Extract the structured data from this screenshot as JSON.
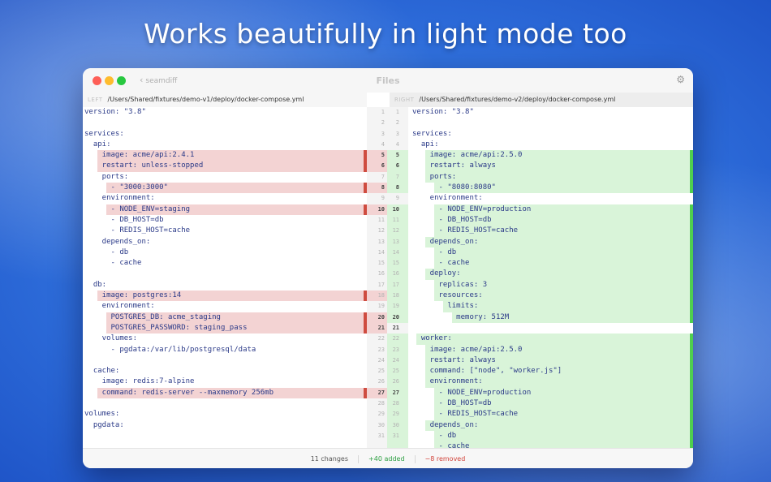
{
  "headline": "Works beautifully in light mode too",
  "window": {
    "title": "Files",
    "back_label": "seamdiff",
    "left_label": "LEFT",
    "left_path": "/Users/Shared/fixtures/demo-v1/deploy/docker-compose.yml",
    "right_label": "RIGHT",
    "right_path": "/Users/Shared/fixtures/demo-v2/deploy/docker-compose.yml"
  },
  "left_lines": [
    {
      "text": "version: \"3.8\"",
      "state": ""
    },
    {
      "text": "",
      "state": ""
    },
    {
      "text": "services:",
      "state": ""
    },
    {
      "text": "  api:",
      "state": ""
    },
    {
      "text": "    image: acme/api:2.4.1",
      "state": "del"
    },
    {
      "text": "    restart: unless-stopped",
      "state": "del"
    },
    {
      "text": "    ports:",
      "state": ""
    },
    {
      "text": "      - \"3000:3000\"",
      "state": "del"
    },
    {
      "text": "    environment:",
      "state": ""
    },
    {
      "text": "      - NODE_ENV=staging",
      "state": "del"
    },
    {
      "text": "      - DB_HOST=db",
      "state": ""
    },
    {
      "text": "      - REDIS_HOST=cache",
      "state": ""
    },
    {
      "text": "    depends_on:",
      "state": ""
    },
    {
      "text": "      - db",
      "state": ""
    },
    {
      "text": "      - cache",
      "state": ""
    },
    {
      "text": "",
      "state": ""
    },
    {
      "text": "  db:",
      "state": ""
    },
    {
      "text": "    image: postgres:14",
      "state": "del"
    },
    {
      "text": "    environment:",
      "state": ""
    },
    {
      "text": "      POSTGRES_DB: acme_staging",
      "state": "del"
    },
    {
      "text": "      POSTGRES_PASSWORD: staging_pass",
      "state": "del"
    },
    {
      "text": "    volumes:",
      "state": ""
    },
    {
      "text": "      - pgdata:/var/lib/postgresql/data",
      "state": ""
    },
    {
      "text": "",
      "state": ""
    },
    {
      "text": "  cache:",
      "state": ""
    },
    {
      "text": "    image: redis:7-alpine",
      "state": ""
    },
    {
      "text": "    command: redis-server --maxmemory 256mb",
      "state": "del"
    },
    {
      "text": "",
      "state": ""
    },
    {
      "text": "volumes:",
      "state": ""
    },
    {
      "text": "  pgdata:",
      "state": ""
    },
    {
      "text": "",
      "state": ""
    },
    {
      "text": "",
      "state": ""
    }
  ],
  "gutter": [
    {
      "a": "1",
      "b": "1",
      "chg": false
    },
    {
      "a": "2",
      "b": "2",
      "chg": false
    },
    {
      "a": "3",
      "b": "3",
      "chg": false
    },
    {
      "a": "4",
      "b": "4",
      "chg": false
    },
    {
      "a": "5",
      "b": "5",
      "chg": true
    },
    {
      "a": "6",
      "b": "6",
      "chg": true
    },
    {
      "a": "7",
      "b": "7",
      "chg": false
    },
    {
      "a": "8",
      "b": "8",
      "chg": true
    },
    {
      "a": "9",
      "b": "9",
      "chg": false
    },
    {
      "a": "10",
      "b": "10",
      "chg": true
    },
    {
      "a": "11",
      "b": "11",
      "chg": false
    },
    {
      "a": "12",
      "b": "12",
      "chg": false
    },
    {
      "a": "13",
      "b": "13",
      "chg": false
    },
    {
      "a": "14",
      "b": "14",
      "chg": false
    },
    {
      "a": "15",
      "b": "15",
      "chg": false
    },
    {
      "a": "16",
      "b": "16",
      "chg": false
    },
    {
      "a": "17",
      "b": "17",
      "chg": false
    },
    {
      "a": "18",
      "b": "18",
      "chg": false
    },
    {
      "a": "19",
      "b": "19",
      "chg": false
    },
    {
      "a": "20",
      "b": "20",
      "chg": true
    },
    {
      "a": "21",
      "b": "21",
      "chg": true
    },
    {
      "a": "22",
      "b": "22",
      "chg": false
    },
    {
      "a": "23",
      "b": "23",
      "chg": false
    },
    {
      "a": "24",
      "b": "24",
      "chg": false
    },
    {
      "a": "25",
      "b": "25",
      "chg": false
    },
    {
      "a": "26",
      "b": "26",
      "chg": false
    },
    {
      "a": "27",
      "b": "27",
      "chg": true
    },
    {
      "a": "28",
      "b": "28",
      "chg": false
    },
    {
      "a": "29",
      "b": "29",
      "chg": false
    },
    {
      "a": "30",
      "b": "30",
      "chg": false
    },
    {
      "a": "31",
      "b": "31",
      "chg": false
    },
    {
      "a": "",
      "b": "",
      "chg": false
    }
  ],
  "right_lines": [
    {
      "text": "version: \"3.8\"",
      "state": ""
    },
    {
      "text": "",
      "state": ""
    },
    {
      "text": "services:",
      "state": ""
    },
    {
      "text": "  api:",
      "state": ""
    },
    {
      "text": "    image: acme/api:2.5.0",
      "state": "add"
    },
    {
      "text": "    restart: always",
      "state": "add"
    },
    {
      "text": "    ports:",
      "state": "add"
    },
    {
      "text": "      - \"8080:8080\"",
      "state": "add"
    },
    {
      "text": "    environment:",
      "state": ""
    },
    {
      "text": "      - NODE_ENV=production",
      "state": "add"
    },
    {
      "text": "      - DB_HOST=db",
      "state": "add"
    },
    {
      "text": "      - REDIS_HOST=cache",
      "state": "add"
    },
    {
      "text": "    depends_on:",
      "state": "add"
    },
    {
      "text": "      - db",
      "state": "add"
    },
    {
      "text": "      - cache",
      "state": "add"
    },
    {
      "text": "    deploy:",
      "state": "add"
    },
    {
      "text": "      replicas: 3",
      "state": "add"
    },
    {
      "text": "      resources:",
      "state": "add"
    },
    {
      "text": "        limits:",
      "state": "add"
    },
    {
      "text": "          memory: 512M",
      "state": "add"
    },
    {
      "text": "",
      "state": ""
    },
    {
      "text": "  worker:",
      "state": "add"
    },
    {
      "text": "    image: acme/api:2.5.0",
      "state": "add"
    },
    {
      "text": "    restart: always",
      "state": "add"
    },
    {
      "text": "    command: [\"node\", \"worker.js\"]",
      "state": "add"
    },
    {
      "text": "    environment:",
      "state": "add"
    },
    {
      "text": "      - NODE_ENV=production",
      "state": "add"
    },
    {
      "text": "      - DB_HOST=db",
      "state": "add"
    },
    {
      "text": "      - REDIS_HOST=cache",
      "state": "add"
    },
    {
      "text": "    depends_on:",
      "state": "add"
    },
    {
      "text": "      - db",
      "state": "add"
    },
    {
      "text": "      - cache",
      "state": "add"
    }
  ],
  "status": {
    "changes": "11 changes",
    "added": "+40 added",
    "removed": "−8 removed"
  },
  "colors": {
    "accent_add": "#4fcf4f",
    "accent_del": "#cf4c40",
    "background": "#2f6fdc"
  }
}
